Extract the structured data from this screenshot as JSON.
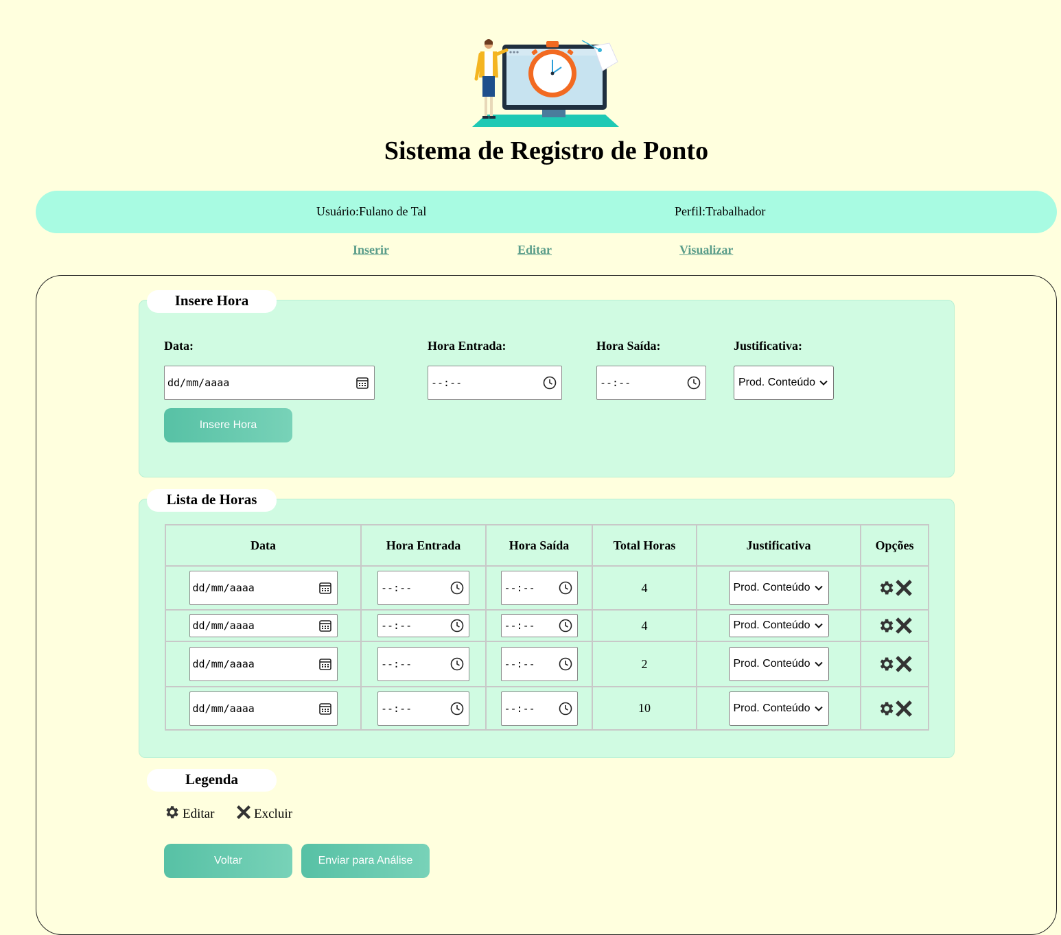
{
  "header": {
    "title": "Sistema de Registro de Ponto",
    "user_label": "Usuário:Fulano de Tal",
    "profile_label": "Perfil:Trabalhador"
  },
  "nav": {
    "insert": "Inserir",
    "edit": "Editar",
    "view": "Visualizar"
  },
  "insert_section": {
    "legend": "Insere Hora",
    "labels": {
      "date": "Data:",
      "entry": "Hora Entrada:",
      "exit": "Hora Saída:",
      "justification": "Justificativa:"
    },
    "date_placeholder": "dd/mm/aaaa",
    "time_placeholder": "--:--",
    "justification_value": "Prod. Conteúdo",
    "submit_label": "Insere Hora"
  },
  "list_section": {
    "legend": "Lista de Horas",
    "columns": [
      "Data",
      "Hora Entrada",
      "Hora Saída",
      "Total Horas",
      "Justificativa",
      "Opções"
    ],
    "rows": [
      {
        "date": "dd/mm/aaaa",
        "entry": "--:--",
        "exit": "--:--",
        "total": "4",
        "justification": "Prod. Conteúdo"
      },
      {
        "date": "dd/mm/aaaa",
        "entry": "--:--",
        "exit": "--:--",
        "total": "4",
        "justification": "Prod. Conteúdo"
      },
      {
        "date": "dd/mm/aaaa",
        "entry": "--:--",
        "exit": "--:--",
        "total": "2",
        "justification": "Prod. Conteúdo"
      },
      {
        "date": "dd/mm/aaaa",
        "entry": "--:--",
        "exit": "--:--",
        "total": "10",
        "justification": "Prod. Conteúdo"
      }
    ]
  },
  "legend_section": {
    "legend": "Legenda",
    "edit_label": "Editar",
    "delete_label": "Excluir"
  },
  "actions": {
    "back": "Voltar",
    "send": "Enviar para Análise"
  },
  "icons": {
    "edit": "gear-icon",
    "delete": "close-icon",
    "date": "calendar-icon",
    "time": "clock-icon"
  },
  "colors": {
    "background": "#ffffde",
    "userbar": "#a8fbe2",
    "section": "#d0fbe2",
    "nav_link": "#5a9d8a",
    "button": "#57c1a5"
  }
}
